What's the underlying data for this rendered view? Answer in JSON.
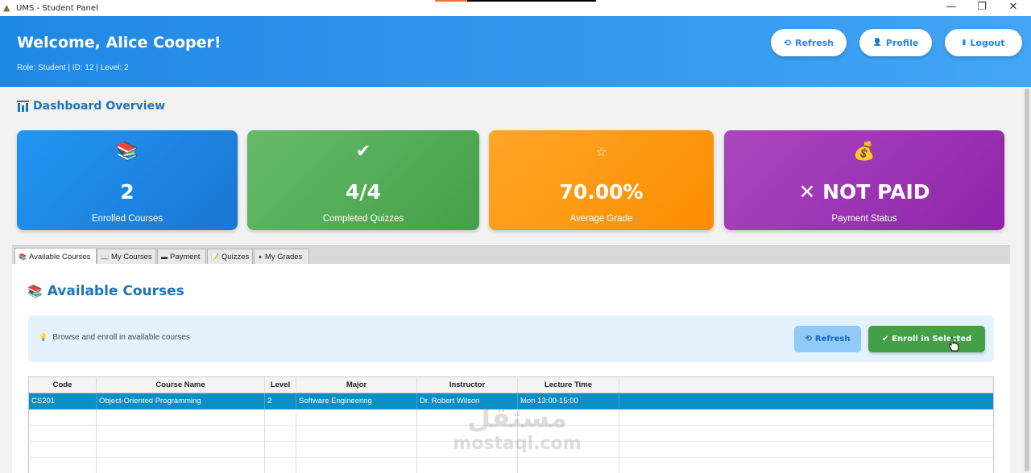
{
  "window": {
    "title": "UMS - Student Panel",
    "app_icon": "triangle-logo-icon",
    "minimize": "—",
    "restore": "❐",
    "close": "✕"
  },
  "header": {
    "welcome": "Welcome, Alice Cooper!",
    "role_line": "Role: Student | ID: 12 | Level: 2",
    "buttons": {
      "refresh": {
        "icon": "⟲",
        "label": "Refresh"
      },
      "profile": {
        "icon": "👤",
        "label": "Profile"
      },
      "logout": {
        "icon": "▮",
        "label": "Logout"
      }
    },
    "gradient": [
      "#1e88e5",
      "#42a5f5"
    ]
  },
  "dashboard": {
    "icon": "chart-bars-icon",
    "title": "Dashboard Overview",
    "cards": [
      {
        "icon": "📚",
        "value": "2",
        "label": "Enrolled Courses",
        "color": "#1e88e5"
      },
      {
        "icon": "✔",
        "value": "4/4",
        "label": "Completed Quizzes",
        "color": "#4caf50"
      },
      {
        "icon": "☆",
        "value": "70.00%",
        "label": "Average Grade",
        "color": "#fb8c00"
      },
      {
        "icon": "💰",
        "value": "✕ NOT PAID",
        "label": "Payment Status",
        "color": "#9c27b0"
      }
    ]
  },
  "tabs": [
    {
      "icon": "📚",
      "label": "Available Courses",
      "active": true
    },
    {
      "icon": "📖",
      "label": "My Courses",
      "active": false
    },
    {
      "icon": "▬",
      "label": "Payment",
      "active": false
    },
    {
      "icon": "📝",
      "label": "Quizzes",
      "active": false
    },
    {
      "icon": "✦",
      "label": "My Grades",
      "active": false
    }
  ],
  "available": {
    "icon": "📚",
    "title": "Available Courses",
    "info_icon": "💡",
    "info": "Browse and enroll in available courses",
    "refresh_icon": "⟲",
    "refresh_label": "Refresh",
    "enroll_icon": "✔",
    "enroll_label": "Enroll in Selected"
  },
  "table": {
    "columns": [
      "Code",
      "Course Name",
      "Level",
      "Major",
      "Instructor",
      "Lecture Time",
      ""
    ],
    "rows": [
      [
        "CS201",
        "Object-Oriented Programming",
        "2",
        "Software Engineering",
        "Dr. Robert Wilson",
        "Mon 13:00-15:00",
        ""
      ]
    ],
    "selected_row": 0
  },
  "watermark": {
    "line1": "مستقل",
    "line2": "mostaql.com"
  }
}
